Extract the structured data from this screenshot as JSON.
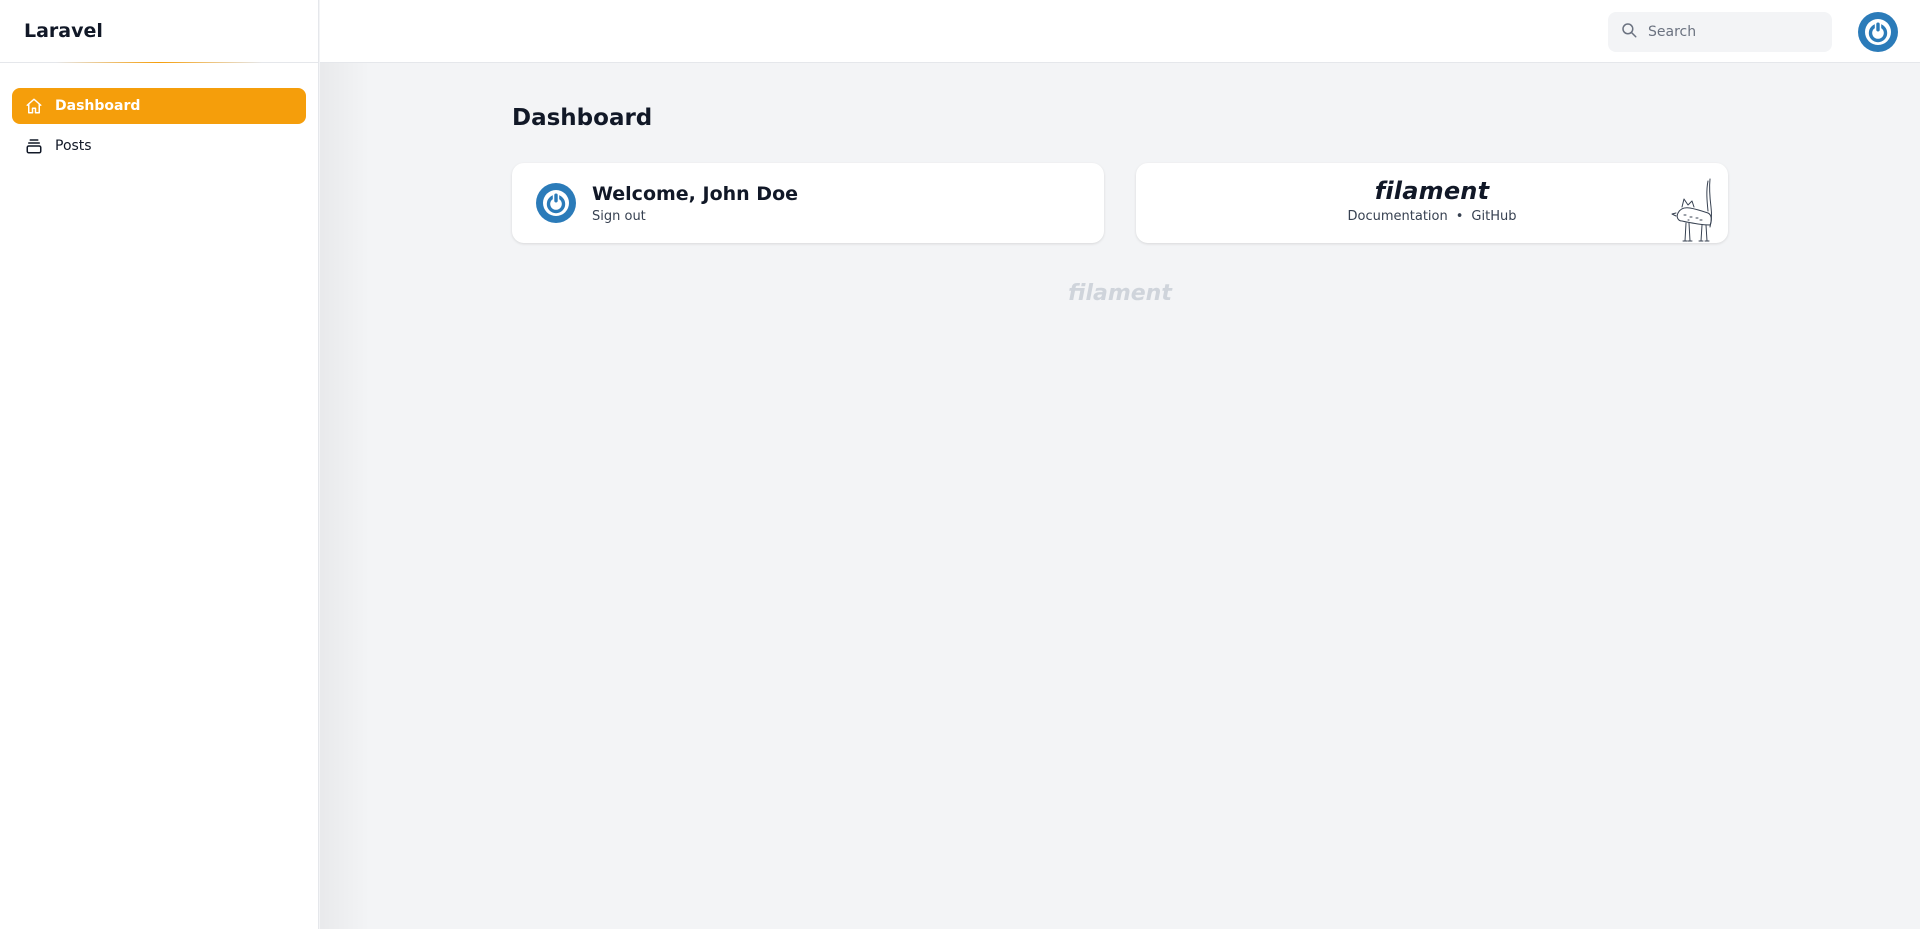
{
  "sidebar": {
    "brand": "Laravel",
    "items": [
      {
        "label": "Dashboard",
        "icon": "home-icon",
        "active": true
      },
      {
        "label": "Posts",
        "icon": "collection-icon",
        "active": false
      }
    ]
  },
  "topbar": {
    "search_placeholder": "Search",
    "user_avatar_icon": "power-icon"
  },
  "main": {
    "page_title": "Dashboard",
    "welcome_widget": {
      "title": "Welcome, John Doe",
      "action": "Sign out",
      "avatar_icon": "power-icon"
    },
    "filament_widget": {
      "logo": "filament",
      "links": [
        "Documentation",
        "GitHub"
      ],
      "separator": "•"
    },
    "footer_logo": "filament"
  },
  "colors": {
    "accent": "#f59e0b",
    "avatar_blue": "#2b7bb9",
    "background": "#f3f4f6"
  }
}
